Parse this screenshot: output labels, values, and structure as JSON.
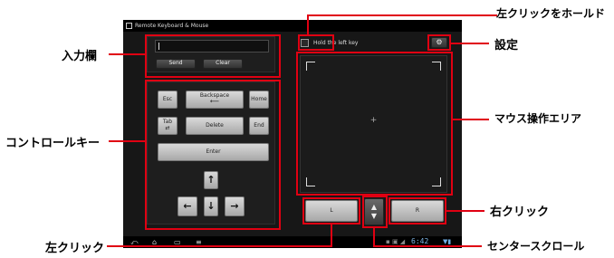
{
  "app": {
    "title": "Remote Keyboard & Mouse"
  },
  "input": {
    "send_label": "Send",
    "clear_label": "Clear"
  },
  "keys": {
    "esc": "Esc",
    "backspace": "Backspace",
    "home": "Home",
    "tab": "Tab",
    "delete": "Delete",
    "end": "End",
    "enter": "Enter"
  },
  "arrows": {
    "up": "↑",
    "left": "←",
    "down": "↓",
    "right": "→"
  },
  "hold": {
    "label": "Hold the left key"
  },
  "mouse_area": {
    "crosshair": "+"
  },
  "buttons": {
    "left": "L",
    "right": "R"
  },
  "statusbar": {
    "clock": "6:42"
  },
  "annotations": {
    "input_field": "入力欄",
    "control_keys": "コントロールキー",
    "left_click": "左クリック",
    "hold_left": "左クリックをホールド",
    "settings": "設定",
    "mouse_area": "マウス操作エリア",
    "right_click": "右クリック",
    "center_scroll": "センタースクロール"
  },
  "colors": {
    "annotation": "#e00012",
    "screen_bg": "#171717"
  }
}
